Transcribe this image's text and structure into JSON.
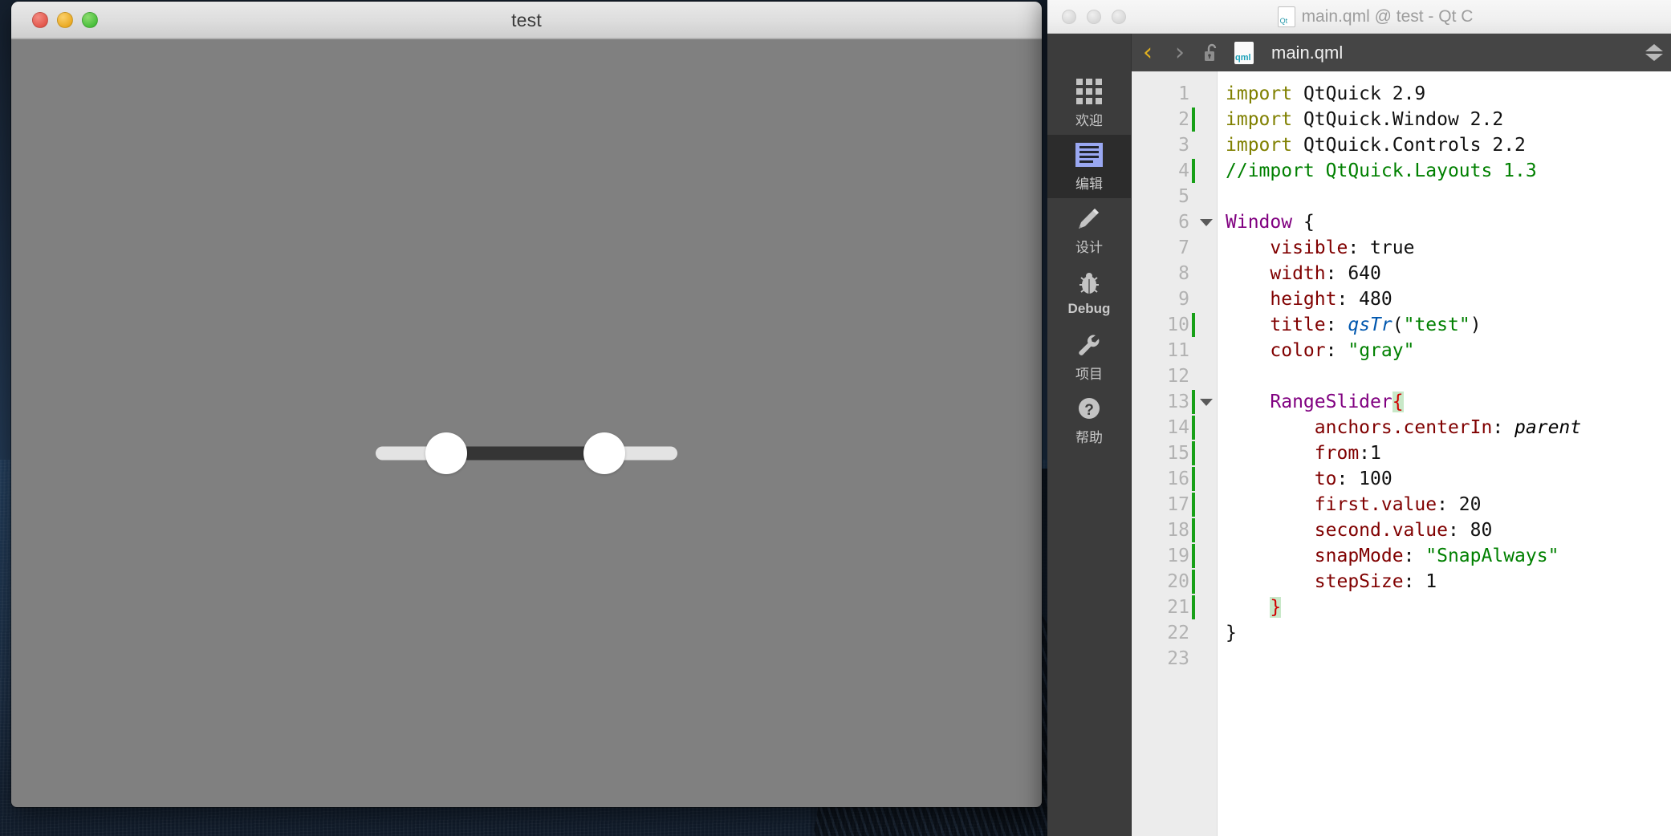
{
  "desktop": {
    "name": "macos-desktop"
  },
  "test_window": {
    "title": "test",
    "traffic_lights": [
      "close",
      "minimize",
      "zoom"
    ],
    "background_color": "#808080",
    "range_slider": {
      "from": 1,
      "to": 100,
      "first_value": 20,
      "second_value": 80,
      "snap_mode": "SnapAlways",
      "step_size": 1,
      "track_color": "#e3e3e3",
      "fill_color": "#353535",
      "handle_color": "#ffffff"
    }
  },
  "qt_creator": {
    "window_title": "main.qml @ test - Qt C",
    "toolbar": {
      "back_label": "‹",
      "forward_label": "›",
      "lock_state": "unlocked",
      "file_type_badge": "qml",
      "filename": "main.qml"
    },
    "modes": [
      {
        "label": "欢迎",
        "icon": "grid-icon",
        "active": false,
        "latin": false
      },
      {
        "label": "编辑",
        "icon": "edit-icon",
        "active": true,
        "latin": false
      },
      {
        "label": "设计",
        "icon": "pencil-icon",
        "active": false,
        "latin": false
      },
      {
        "label": "Debug",
        "icon": "bug-icon",
        "active": false,
        "latin": true
      },
      {
        "label": "项目",
        "icon": "wrench-icon",
        "active": false,
        "latin": false
      },
      {
        "label": "帮助",
        "icon": "help-icon",
        "active": false,
        "latin": false
      }
    ],
    "editor": {
      "language": "qml",
      "total_lines": 23,
      "lines": [
        {
          "n": 1,
          "changed": false,
          "fold": false
        },
        {
          "n": 2,
          "changed": true,
          "fold": false
        },
        {
          "n": 3,
          "changed": false,
          "fold": false
        },
        {
          "n": 4,
          "changed": true,
          "fold": false
        },
        {
          "n": 5,
          "changed": false,
          "fold": false
        },
        {
          "n": 6,
          "changed": false,
          "fold": true
        },
        {
          "n": 7,
          "changed": false,
          "fold": false
        },
        {
          "n": 8,
          "changed": false,
          "fold": false
        },
        {
          "n": 9,
          "changed": false,
          "fold": false
        },
        {
          "n": 10,
          "changed": true,
          "fold": false
        },
        {
          "n": 11,
          "changed": false,
          "fold": false
        },
        {
          "n": 12,
          "changed": false,
          "fold": false
        },
        {
          "n": 13,
          "changed": true,
          "fold": true
        },
        {
          "n": 14,
          "changed": true,
          "fold": false
        },
        {
          "n": 15,
          "changed": true,
          "fold": false
        },
        {
          "n": 16,
          "changed": true,
          "fold": false
        },
        {
          "n": 17,
          "changed": true,
          "fold": false
        },
        {
          "n": 18,
          "changed": true,
          "fold": false
        },
        {
          "n": 19,
          "changed": true,
          "fold": false
        },
        {
          "n": 20,
          "changed": true,
          "fold": false
        },
        {
          "n": 21,
          "changed": true,
          "fold": false
        },
        {
          "n": 22,
          "changed": false,
          "fold": false
        },
        {
          "n": 23,
          "changed": false,
          "fold": false
        }
      ],
      "source_text": "import QtQuick 2.9\nimport QtQuick.Window 2.2\nimport QtQuick.Controls 2.2\n//import QtQuick.Layouts 1.3\n\nWindow {\n    visible: true\n    width: 640\n    height: 480\n    title: qsTr(\"test\")\n    color: \"gray\"\n\n    RangeSlider{\n        anchors.centerIn: parent\n        from:1\n        to: 100\n        first.value: 20\n        second.value: 80\n        snapMode: \"SnapAlways\"\n        stepSize: 1\n    }\n}\n"
    },
    "colors": {
      "keyword": "#808000",
      "comment": "#008000",
      "type": "#800080",
      "property": "#800000",
      "string": "#008000",
      "function": "#0057ae",
      "change_marker": "#18a018",
      "brace_match_bg": "#c8e8c8",
      "sidebar_bg": "#3c3c3c",
      "toolbar_bg": "#454545"
    }
  }
}
